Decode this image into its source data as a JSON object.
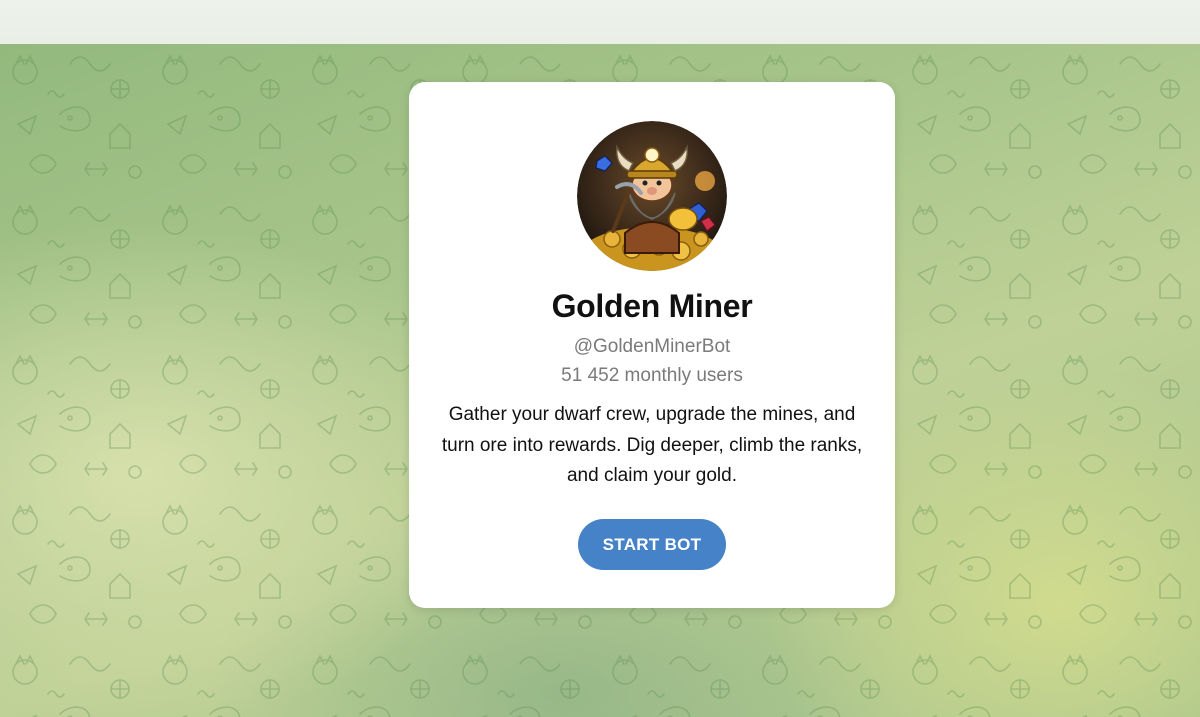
{
  "bot": {
    "name": "Golden Miner",
    "username": "@GoldenMinerBot",
    "monthly_users": "51 452 monthly users",
    "description": "Gather your dwarf crew, upgrade the mines, and turn ore into rewards. Dig deeper, climb the ranks, and claim your gold.",
    "avatar_icon": "dwarf-miner-avatar"
  },
  "actions": {
    "start_label": "START BOT"
  },
  "colors": {
    "accent": "#4682c8",
    "card": "#ffffff",
    "backdrop": "#a9c68c",
    "muted_text": "#7a7a7a"
  }
}
